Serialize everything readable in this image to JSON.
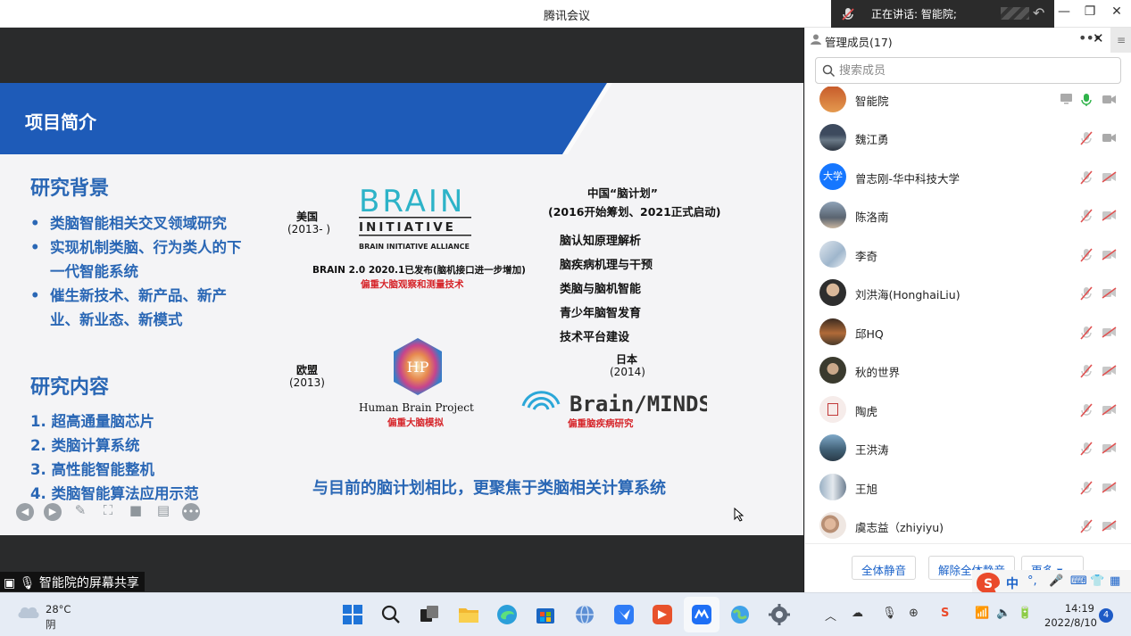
{
  "window": {
    "title": "腾讯会议",
    "speaker_label": "正在讲话: 智能院;"
  },
  "slide": {
    "title": "项目简介",
    "background_heading": "研究背景",
    "background_bullets": [
      "类脑智能相关交叉领域研究",
      "实现机制类脑、行为类人的下一代智能系统",
      "催生新技术、新产品、新产业、新业态、新模式"
    ],
    "content_heading": "研究内容",
    "content_items": [
      "1.  超高通量脑芯片",
      "2.  类脑计算系统",
      "3.  高性能智能整机",
      "4.  类脑智能算法应用示范"
    ],
    "usa": {
      "name": "美国",
      "year": "(2013- )"
    },
    "brain_logo": {
      "line1": "BRAIN",
      "line2": "INITIATIVE",
      "line3": "BRAIN INITIATIVE ALLIANCE"
    },
    "brain_note": "BRAIN 2.0 2020.1已发布(脑机接口进一步增加)",
    "brain_focus": "偏重大脑观察和测量技术",
    "china": {
      "name": "中国“脑计划”",
      "period": "(2016开始筹划、2021正式启动)"
    },
    "china_items": [
      "脑认知原理解析",
      "脑疾病机理与干预",
      "类脑与脑机智能",
      "青少年脑智发育",
      "技术平台建设"
    ],
    "eu": {
      "name": "欧盟",
      "year": "(2013)"
    },
    "hbp_logo_letters": "HP",
    "hbp_name": "Human Brain Project",
    "hbp_focus": "偏重大脑模拟",
    "japan": {
      "name": "日本",
      "year": "(2014)"
    },
    "minds_name": "Brain/MINDS",
    "minds_focus": "偏重脑疾病研究",
    "summary": "与目前的脑计划相比，更聚焦于类脑相关计算系统"
  },
  "share_label": "智能院的屏幕共享",
  "panel": {
    "title": "管理成员(17)",
    "search_placeholder": "搜索成员",
    "members": [
      {
        "name": "智能院",
        "avatar_text": ""
      },
      {
        "name": "魏江勇",
        "avatar_text": ""
      },
      {
        "name": "曾志刚-华中科技大学",
        "avatar_text": "大学"
      },
      {
        "name": "陈洛南",
        "avatar_text": ""
      },
      {
        "name": "李奇",
        "avatar_text": ""
      },
      {
        "name": "刘洪海(HonghaiLiu)",
        "avatar_text": ""
      },
      {
        "name": "邱HQ",
        "avatar_text": ""
      },
      {
        "name": "秋的世界",
        "avatar_text": ""
      },
      {
        "name": "陶虎",
        "avatar_text": ""
      },
      {
        "name": "王洪涛",
        "avatar_text": ""
      },
      {
        "name": "王旭",
        "avatar_text": ""
      },
      {
        "name": "虞志益（zhiyiyu)",
        "avatar_text": ""
      }
    ],
    "mute_all": "全体静音",
    "unmute_all": "解除全体静音",
    "more": "更多 ▾"
  },
  "taskbar": {
    "temperature": "28°C",
    "weather": "阴",
    "time": "14:19",
    "date": "2022/8/10",
    "notifications": "4"
  },
  "ime": {
    "lang": "中"
  },
  "colors": {
    "slide_blue": "#1e5bb8",
    "text_blue": "#2a67b5",
    "accent_red": "#d6262b",
    "mic_green": "#2fb34a",
    "muted_red": "#e05050"
  }
}
